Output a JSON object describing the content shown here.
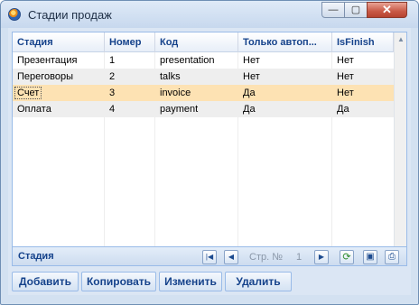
{
  "window": {
    "title": "Стадии продаж",
    "controls": {
      "minimize": "—",
      "maximize": "▢",
      "close": "✕"
    }
  },
  "grid": {
    "columns": [
      "Стадия",
      "Номер",
      "Код",
      "Только автоп...",
      "IsFinish"
    ],
    "rows": [
      [
        "Презентация",
        "1",
        "presentation",
        "Нет",
        "Нет"
      ],
      [
        "Переговоры",
        "2",
        "talks",
        "Нет",
        "Нет"
      ],
      [
        "Счет",
        "3",
        "invoice",
        "Да",
        "Нет"
      ],
      [
        "Оплата",
        "4",
        "payment",
        "Да",
        "Да"
      ]
    ],
    "selected_row": 2
  },
  "pager": {
    "label": "Стадия",
    "page_prefix": "Стр. №",
    "page_number": "1",
    "icons": [
      "first-page-icon",
      "prev-page-icon",
      "next-page-icon",
      "refresh-icon",
      "save-icon",
      "print-icon"
    ]
  },
  "toolbar": {
    "add_label": "Добавить",
    "copy_label": "Копировать",
    "edit_label": "Изменить",
    "delete_label": "Удалить"
  },
  "colors": {
    "header_text": "#15428b",
    "selected_row": "#fde2b3",
    "alt_row": "#eeeeee",
    "border": "#99bbe8"
  }
}
